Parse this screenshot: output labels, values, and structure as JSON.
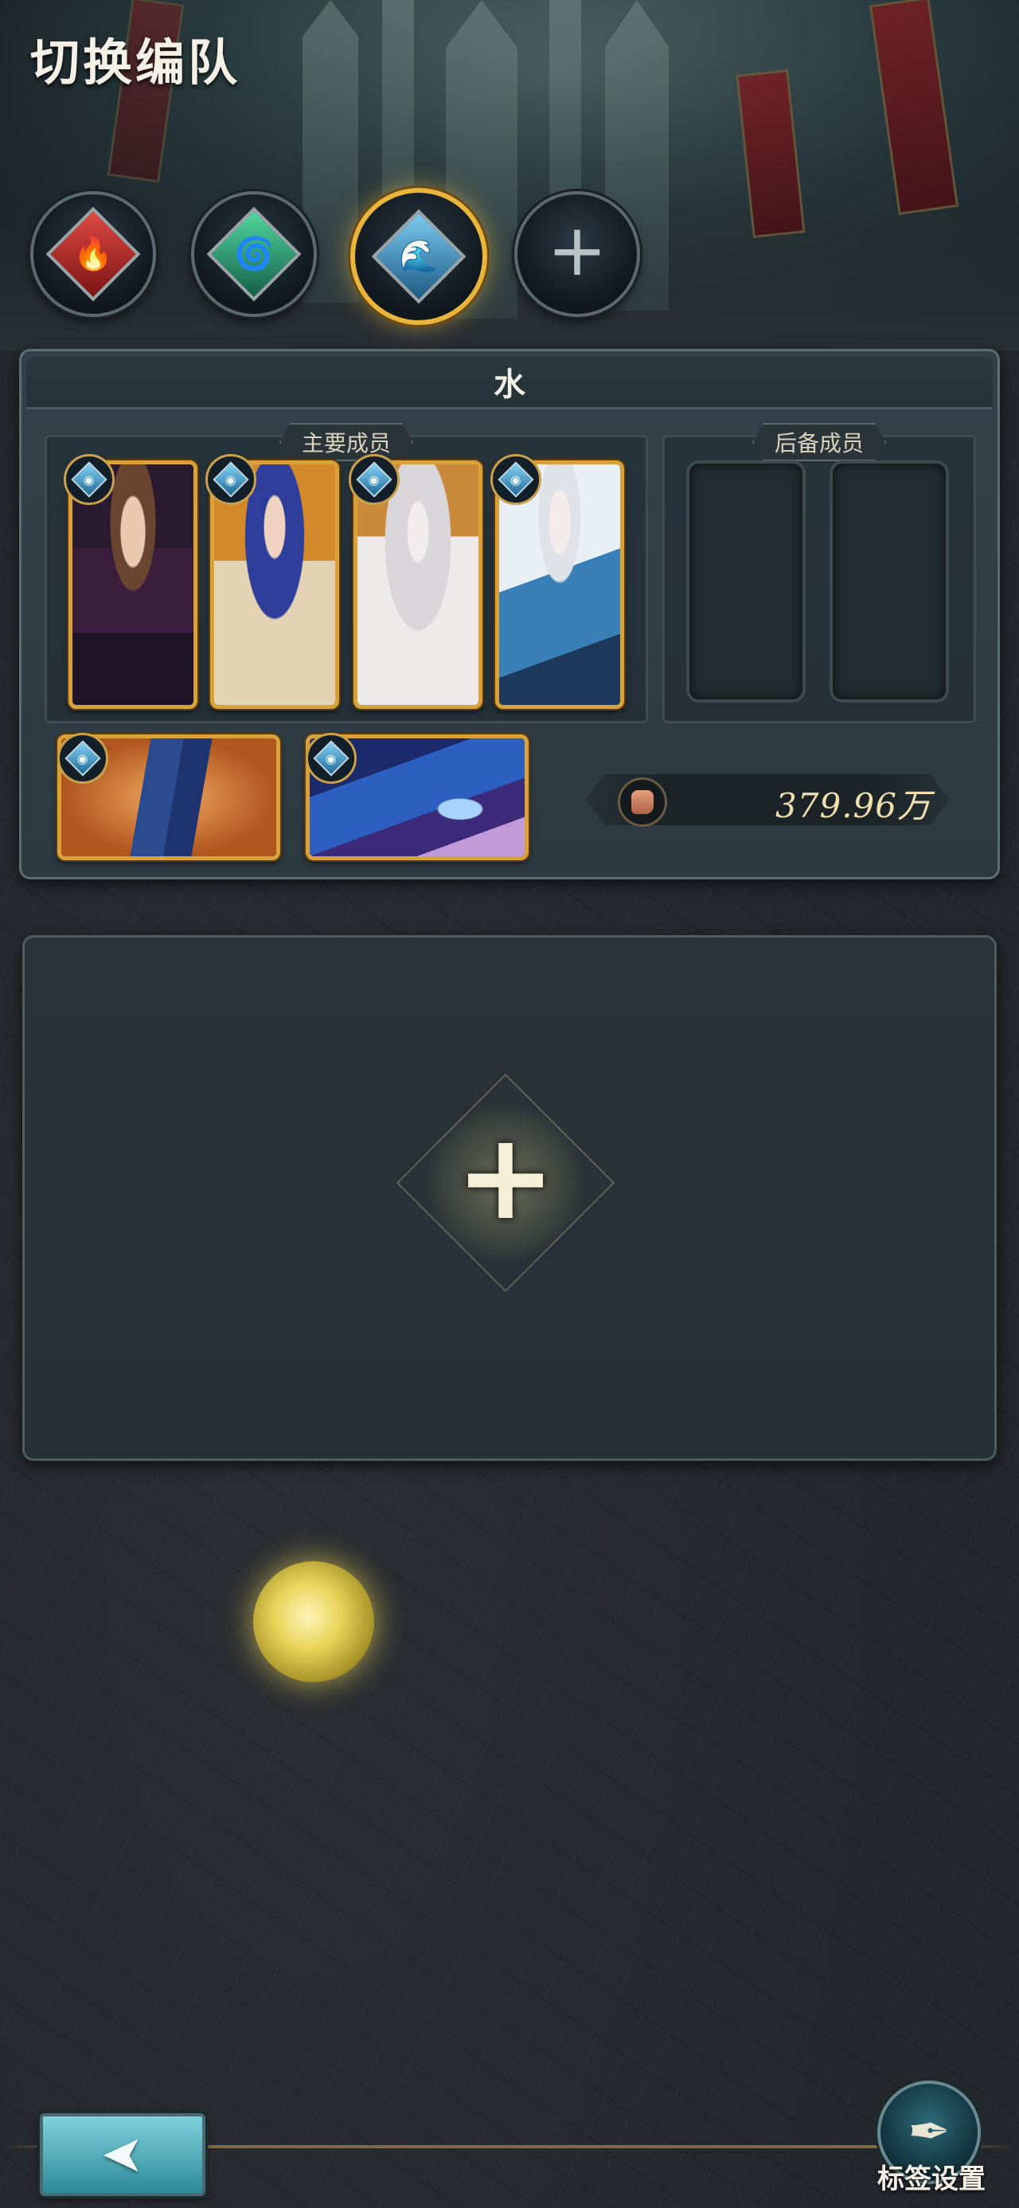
{
  "header": {
    "title": "切换编队"
  },
  "team_tabs": [
    {
      "id": "fire",
      "icon": "fire-element-icon",
      "glyph": "🔥",
      "active": false
    },
    {
      "id": "wind",
      "icon": "wind-element-icon",
      "glyph": "🌀",
      "active": false
    },
    {
      "id": "water",
      "icon": "water-element-icon",
      "glyph": "🌊",
      "active": true
    },
    {
      "id": "add",
      "icon": "plus-icon",
      "glyph": "+",
      "active": false
    }
  ],
  "team_panel": {
    "title": "水",
    "main_members_label": "主要成员",
    "reserve_members_label": "后备成员",
    "power_value": "379.96万"
  },
  "colors": {
    "accent_gold": "#d8a13a",
    "water_element": "#1f6a98",
    "panel": "#33424a"
  },
  "bottom_bar": {
    "back_glyph": "➤",
    "tag_settings_label": "标签设置",
    "tag_settings_icon_glyph": "✒"
  }
}
